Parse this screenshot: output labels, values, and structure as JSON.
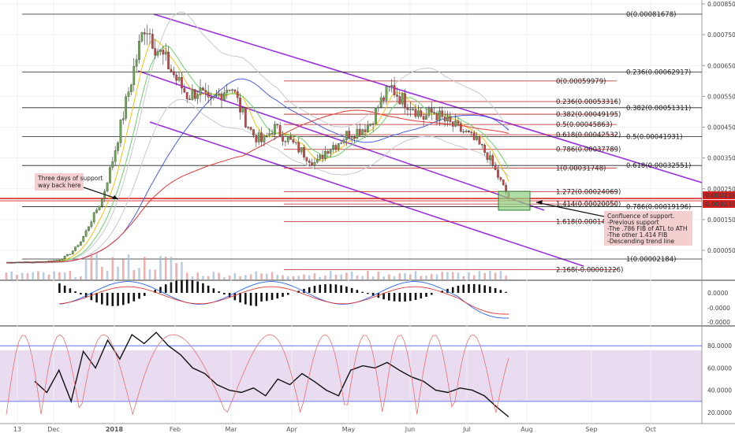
{
  "chart_data": {
    "type": "candlestick",
    "price_axis": {
      "ticks": [
        "0.00085000",
        "0.00075000",
        "0.00065000",
        "0.00055000",
        "0.00045000",
        "0.00035000",
        "0.00025000",
        "0.00015000",
        "0.00005000"
      ],
      "tick_values": [
        0.00085,
        0.00075,
        0.00065,
        0.00055,
        0.00045,
        0.00035,
        0.00025,
        0.00015,
        5e-05
      ],
      "range": [
        -2e-05,
        0.00086
      ],
      "markers": [
        {
          "label": "0.00021839",
          "value": 0.00021839,
          "color": "#d81b1b"
        },
        {
          "label": "0.00021089",
          "value": 0.00021089,
          "color": "#d81b1b"
        }
      ]
    },
    "x_axis": {
      "labels": [
        "13",
        "Dec",
        "2018",
        "Feb",
        "Mar",
        "Apr",
        "May",
        "Jun",
        "Jul",
        "Aug",
        "Sep",
        "Oct"
      ],
      "bold": [
        "2018"
      ]
    },
    "fib_primary": {
      "color": "#222222",
      "levels": [
        {
          "label": "0(0.00081678)",
          "value": 0.00081678
        },
        {
          "label": "0.236(0.00062917)",
          "value": 0.00062917
        },
        {
          "label": "0.382(0.00051311)",
          "value": 0.00051311
        },
        {
          "label": "0.5(0.00041931)",
          "value": 0.00041931
        },
        {
          "label": "0.618(0.00032551)",
          "value": 0.00032551
        },
        {
          "label": "0.786(0.00019196)",
          "value": 0.00019196
        },
        {
          "label": "1(0.00002184)",
          "value": 2.184e-05
        }
      ]
    },
    "fib_secondary": {
      "color": "#b71c1c",
      "levels": [
        {
          "label": "0(0.00059979)",
          "value": 0.00059979
        },
        {
          "label": "0.236(0.00053316)",
          "value": 0.00053316
        },
        {
          "label": "0.382(0.00049195)",
          "value": 0.00049195
        },
        {
          "label": "0.5(0.00045863)",
          "value": 0.00045863
        },
        {
          "label": "0.618(0.00042532)",
          "value": 0.00042532
        },
        {
          "label": "0.786(0.00037789)",
          "value": 0.00037789
        },
        {
          "label": "1(0.00031748)",
          "value": 0.00031748
        },
        {
          "label": "1.272(0.00024069)",
          "value": 0.00024069
        },
        {
          "label": "1.414(0.00020050)",
          "value": 0.0002005
        },
        {
          "label": "1.618(0.00014301)",
          "value": 0.00014301
        },
        {
          "label": "2.168(-0.00001226)",
          "value": -1.226e-05
        }
      ]
    },
    "price_path": [
      1e-05,
      1.2e-05,
      1.1e-05,
      1.3e-05,
      1.5e-05,
      2e-05,
      4e-05,
      8e-05,
      0.00015,
      0.00022,
      0.00035,
      0.0005,
      0.00065,
      0.00079,
      0.00071,
      0.00066,
      0.0006,
      0.00055,
      0.00057,
      0.00052,
      0.00056,
      0.00059,
      0.0005,
      0.00043,
      0.0004,
      0.00045,
      0.00042,
      0.00039,
      0.00036,
      0.00033,
      0.00038,
      0.0004,
      0.00043,
      0.00044,
      0.00046,
      0.00053,
      0.00058,
      0.00054,
      0.00052,
      0.00048,
      0.0005,
      0.00047,
      0.00045,
      0.00043,
      0.0004,
      0.00036,
      0.00029,
      0.00022
    ],
    "oscillator_axis": {
      "ticks": [
        "0.0000",
        "-0.0000",
        "-0.0000"
      ]
    },
    "rsi_axis": {
      "ticks": [
        "80.0000",
        "60.0000",
        "40.0000",
        "20.0000"
      ],
      "tick_values": [
        80,
        60,
        40,
        20
      ]
    },
    "rsi_path": [
      48,
      38,
      58,
      30,
      75,
      60,
      85,
      68,
      90,
      82,
      92,
      80,
      72,
      60,
      55,
      45,
      40,
      38,
      42,
      35,
      50,
      45,
      55,
      48,
      40,
      35,
      58,
      62,
      60,
      65,
      58,
      52,
      48,
      40,
      38,
      42,
      40,
      35,
      25,
      16
    ],
    "annotations": [
      {
        "id": "support-note",
        "lines": [
          "Three days of support",
          "way back here"
        ]
      },
      {
        "id": "confluence-note",
        "lines": [
          "Confluence of support.",
          "-Previous support",
          "-The .786 FIB of ATL to ATH",
          "-The other 1.414 FIB",
          "-Descending trend line"
        ]
      }
    ]
  }
}
